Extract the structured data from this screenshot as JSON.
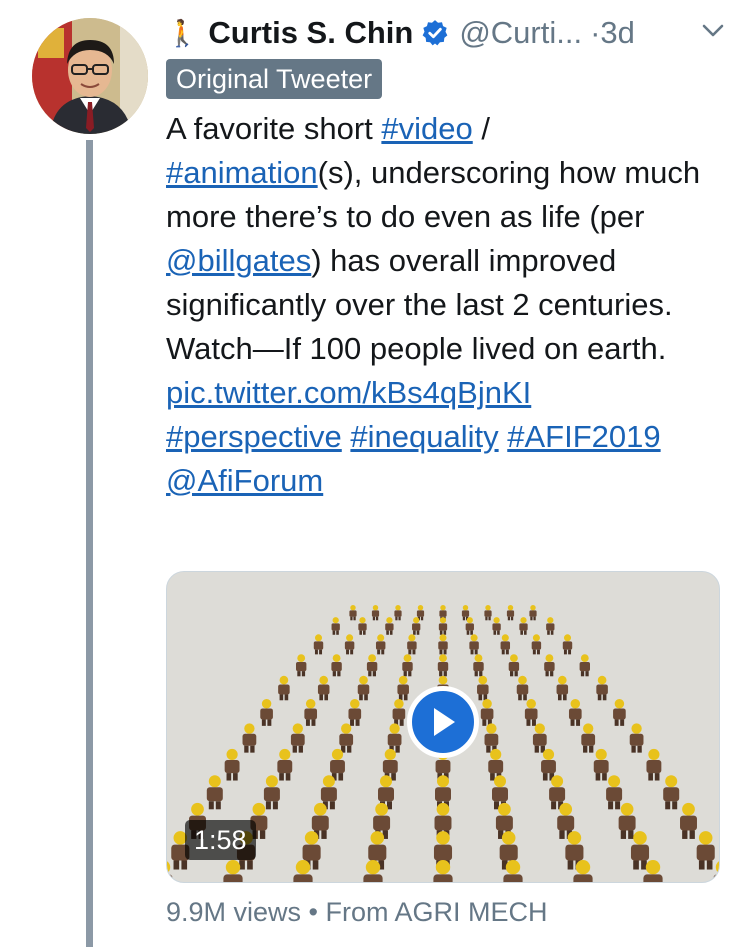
{
  "tweet": {
    "author_emoji": "🚶",
    "author_name": "Curtis S. Chin",
    "handle": "@Curti...",
    "time": "·3d",
    "badge": "Original Tweeter",
    "text": {
      "p1": "A favorite short ",
      "tag_video": "#video",
      "p2": " / ",
      "tag_animation": "#animation",
      "p3": "(s), underscoring how much more there’s to do even as life (per ",
      "mention_billgates": "@billgates",
      "p4": ") has overall improved significantly over the last 2 centuries. Watch—If 100 people lived on earth.",
      "link": "pic.twitter.com/kBs4qBjnKI",
      "tag_perspective": "#perspective",
      "tag_inequality": "#inequality",
      "tag_afif": "#AFIF2019",
      "mention_afiforum": "@AfiForum"
    },
    "media": {
      "duration": "1:58"
    },
    "meta": "9.9M views • From AGRI MECH"
  },
  "icons": {
    "verified": "verified-badge-icon",
    "chevron": "chevron-down-icon",
    "play": "play-icon"
  },
  "colors": {
    "link": "#1a63b6",
    "badge_bg": "#657786",
    "thread_line": "#8c99a6",
    "play_button": "#1d6fd6"
  }
}
